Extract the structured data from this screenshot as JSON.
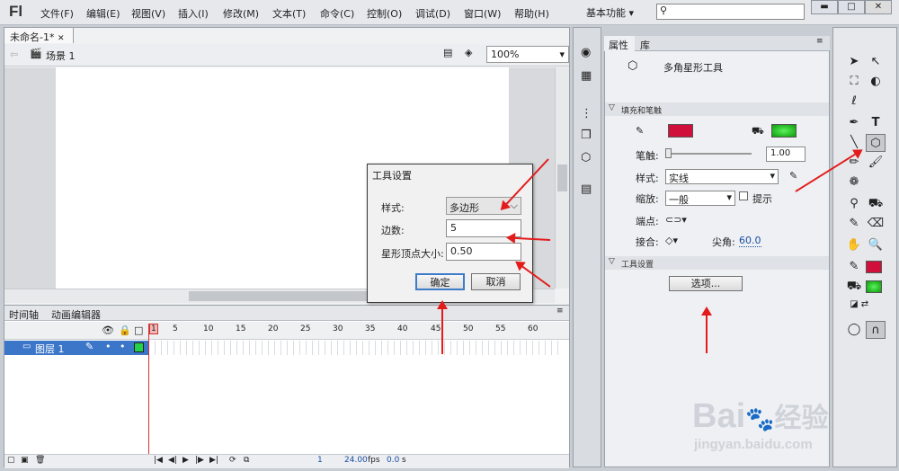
{
  "menu": {
    "logo": "Fl",
    "items": [
      "文件(F)",
      "编辑(E)",
      "视图(V)",
      "插入(I)",
      "修改(M)",
      "文本(T)",
      "命令(C)",
      "控制(O)",
      "调试(D)",
      "窗口(W)",
      "帮助(H)"
    ],
    "workspace": "基本功能"
  },
  "document": {
    "tab": "未命名-1*",
    "scene": "场景 1",
    "zoom": "100%"
  },
  "timeline": {
    "tabs": [
      "时间轴",
      "动画编辑器"
    ],
    "frame_numbers": [
      "1",
      "5",
      "10",
      "15",
      "20",
      "25",
      "30",
      "35",
      "40",
      "45",
      "50",
      "55",
      "60"
    ],
    "layer": "图层 1",
    "fps": "24.00",
    "fps_unit": "fps",
    "time": "0.0",
    "time_unit": "s",
    "frame": "1"
  },
  "props": {
    "tabs": [
      "属性",
      "库"
    ],
    "tool_name": "多角星形工具",
    "section_fill": "填充和笔触",
    "stroke_label": "笔触:",
    "stroke_value": "1.00",
    "style_label": "样式:",
    "style_value": "实线",
    "scale_label": "缩放:",
    "scale_value": "一般",
    "hint_label": "提示",
    "cap_label": "端点:",
    "join_label": "接合:",
    "miter_label": "尖角:",
    "miter_value": "60.0",
    "section_tool": "工具设置",
    "options_btn": "选项..."
  },
  "dialog": {
    "title": "工具设置",
    "style_label": "样式:",
    "style_value": "多边形",
    "sides_label": "边数:",
    "sides_value": "5",
    "star_label": "星形顶点大小:",
    "star_value": "0.50",
    "ok": "确定",
    "cancel": "取消"
  },
  "colors": {
    "stroke": "#d0103a",
    "fill": "#1ec21e",
    "layer_bg": "#3c76c9",
    "arrow": "#e31b1b"
  },
  "watermark": {
    "brand": "Bai",
    "brand2": "经验",
    "url": "jingyan.baidu.com"
  }
}
